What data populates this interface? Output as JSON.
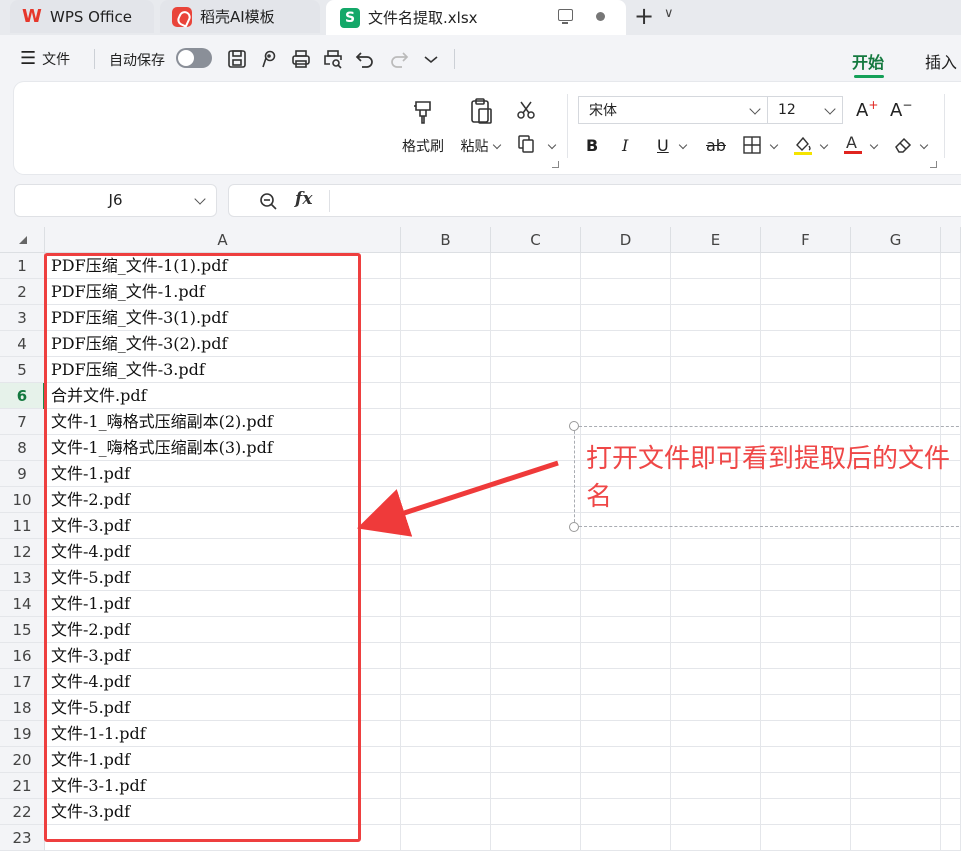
{
  "tabs": {
    "wps": "WPS Office",
    "daoke": "稻壳AI模板",
    "file": "文件名提取.xlsx",
    "file_icon_letter": "S"
  },
  "menubar": {
    "file_menu": "文件",
    "autosave": "自动保存",
    "ribbon_tabs": [
      "开始",
      "插入"
    ]
  },
  "ribbon": {
    "format_painter": "格式刷",
    "paste": "粘贴",
    "font_name": "宋体",
    "font_size": "12",
    "bold": "B",
    "italic": "I",
    "underline": "U",
    "strike": "ab",
    "colors": {
      "highlight": "#f5e400",
      "font": "#e0241f"
    }
  },
  "formula_bar": {
    "name_box": "J6",
    "fx": "fx",
    "content": ""
  },
  "sheet": {
    "columns": [
      "A",
      "B",
      "C",
      "D",
      "E",
      "F",
      "G"
    ],
    "rows": [
      "1",
      "2",
      "3",
      "4",
      "5",
      "6",
      "7",
      "8",
      "9",
      "10",
      "11",
      "12",
      "13",
      "14",
      "15",
      "16",
      "17",
      "18",
      "19",
      "20",
      "21",
      "22",
      "23"
    ],
    "active_row": "6",
    "column_a": [
      "PDF压缩_文件-1(1).pdf",
      "PDF压缩_文件-1.pdf",
      "PDF压缩_文件-3(1).pdf",
      "PDF压缩_文件-3(2).pdf",
      "PDF压缩_文件-3.pdf",
      "合并文件.pdf",
      "文件-1_嗨格式压缩副本(2).pdf",
      "文件-1_嗨格式压缩副本(3).pdf",
      "文件-1.pdf",
      "文件-2.pdf",
      "文件-3.pdf",
      "文件-4.pdf",
      "文件-5.pdf",
      "文件-1.pdf",
      "文件-2.pdf",
      "文件-3.pdf",
      "文件-4.pdf",
      "文件-5.pdf",
      "文件-1-1.pdf",
      "文件-1.pdf",
      "文件-3-1.pdf",
      "文件-3.pdf",
      ""
    ]
  },
  "annotation": {
    "text": "打开文件即可看到提取后的文件名",
    "color": "#ef4747"
  }
}
